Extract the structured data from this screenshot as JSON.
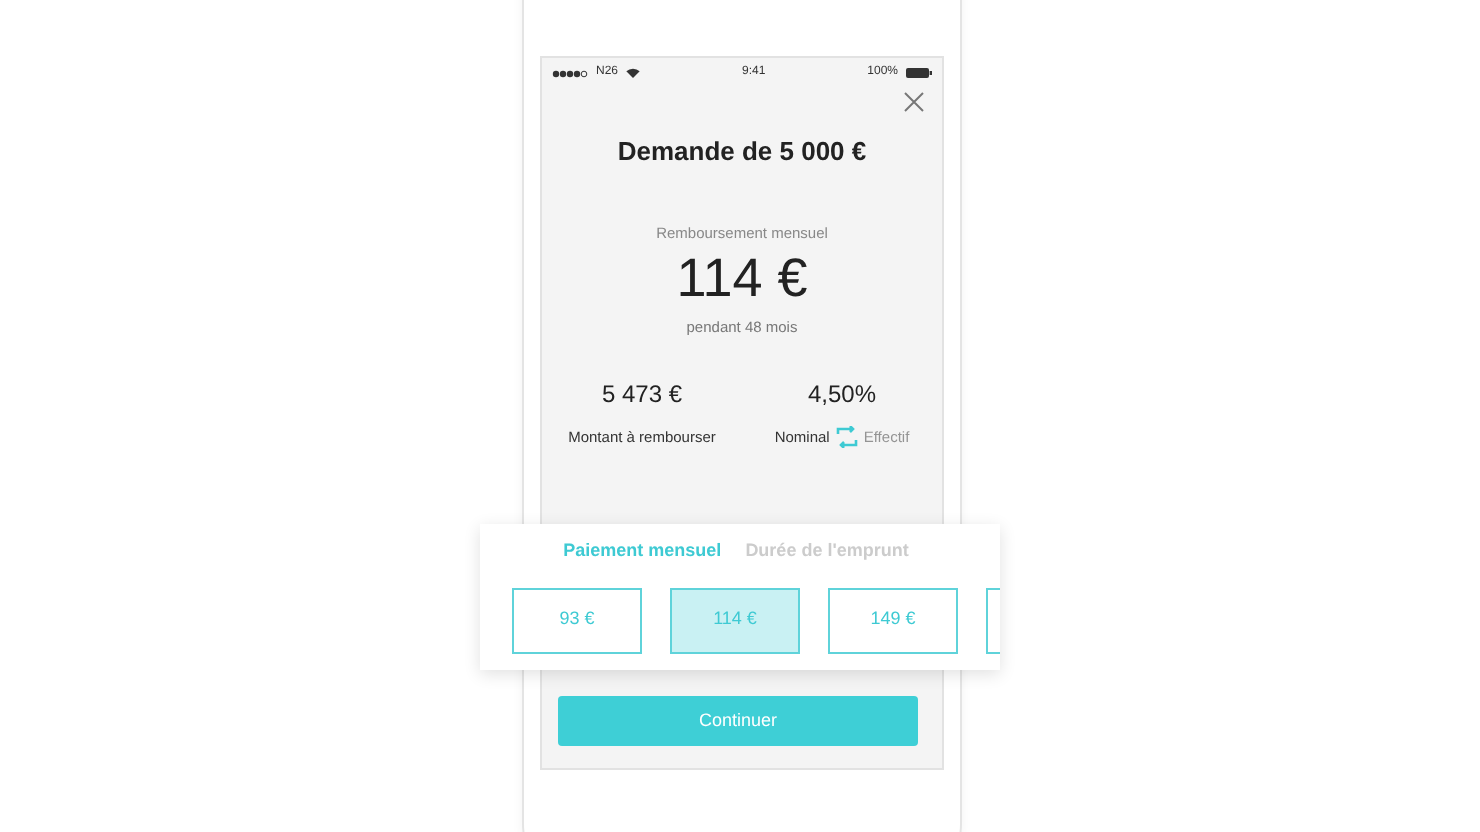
{
  "status_bar": {
    "carrier": "N26",
    "time": "9:41",
    "battery": "100%"
  },
  "title": "Demande de 5 000 €",
  "repayment": {
    "label": "Remboursement mensuel",
    "amount": "114 €",
    "duration": "pendant 48 mois"
  },
  "summary": {
    "total": "5 473 €",
    "total_label": "Montant à rembourser",
    "rate": "4,50%",
    "rate_types": [
      {
        "label": "Nominal",
        "selected": true
      },
      {
        "label": "Effectif",
        "selected": false
      }
    ]
  },
  "tabs": [
    {
      "label": "Paiement mensuel",
      "selected": true
    },
    {
      "label": "Durée de l'emprunt",
      "selected": false
    }
  ],
  "options": [
    {
      "label": "93 €",
      "selected": false
    },
    {
      "label": "114 €",
      "selected": true
    },
    {
      "label": "149 €",
      "selected": false
    },
    {
      "selected": false
    }
  ],
  "button": "Continuer"
}
